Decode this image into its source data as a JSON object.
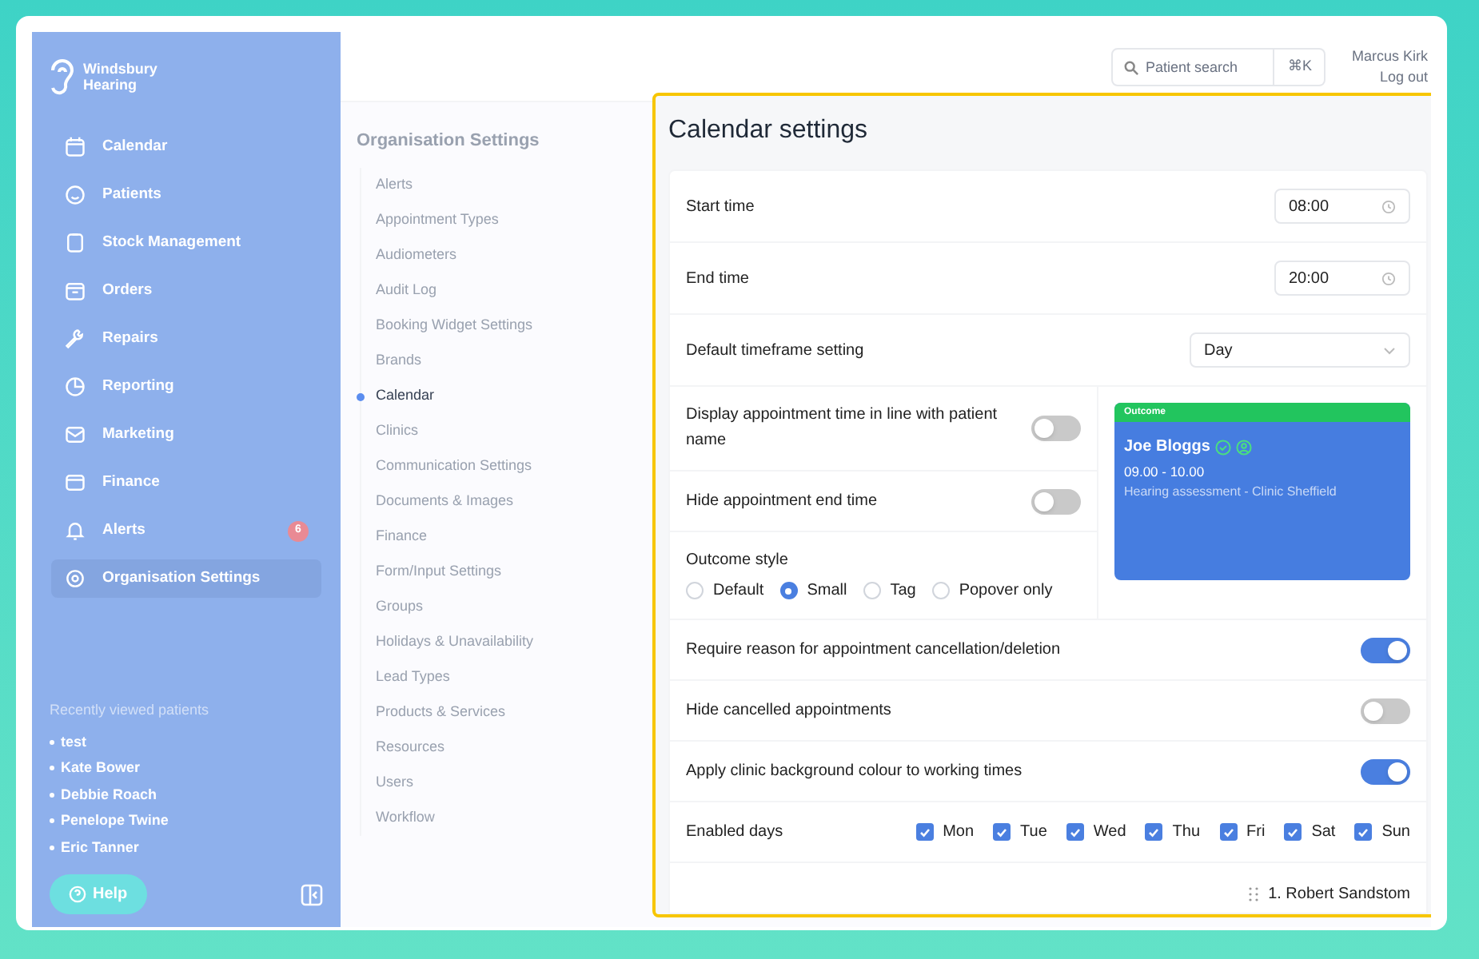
{
  "brand": {
    "line1": "Windsbury",
    "line2": "Hearing"
  },
  "nav": [
    {
      "label": "Calendar",
      "selected": false
    },
    {
      "label": "Patients",
      "selected": false
    },
    {
      "label": "Stock Management",
      "selected": false
    },
    {
      "label": "Orders",
      "selected": false
    },
    {
      "label": "Repairs",
      "selected": false
    },
    {
      "label": "Reporting",
      "selected": false
    },
    {
      "label": "Marketing",
      "selected": false
    },
    {
      "label": "Finance",
      "selected": false
    },
    {
      "label": "Alerts",
      "selected": false,
      "badge": "6"
    },
    {
      "label": "Organisation Settings",
      "selected": true
    }
  ],
  "recent": {
    "title": "Recently viewed patients",
    "items": [
      "test",
      "Kate Bower",
      "Debbie Roach",
      "Penelope Twine",
      "Eric Tanner"
    ]
  },
  "help": "Help",
  "header": {
    "search_placeholder": "Patient search",
    "shortcut": "⌘K",
    "user": "Marcus Kirk",
    "logout": "Log out"
  },
  "settings_nav": {
    "title": "Organisation Settings",
    "items": [
      {
        "label": "Alerts",
        "selected": false
      },
      {
        "label": "Appointment Types",
        "selected": false
      },
      {
        "label": "Audiometers",
        "selected": false
      },
      {
        "label": "Audit Log",
        "selected": false
      },
      {
        "label": "Booking Widget Settings",
        "selected": false
      },
      {
        "label": "Brands",
        "selected": false
      },
      {
        "label": "Calendar",
        "selected": true
      },
      {
        "label": "Clinics",
        "selected": false
      },
      {
        "label": "Communication Settings",
        "selected": false
      },
      {
        "label": "Documents & Images",
        "selected": false
      },
      {
        "label": "Finance",
        "selected": false
      },
      {
        "label": "Form/Input Settings",
        "selected": false
      },
      {
        "label": "Groups",
        "selected": false
      },
      {
        "label": "Holidays & Unavailability",
        "selected": false
      },
      {
        "label": "Lead Types",
        "selected": false
      },
      {
        "label": "Products & Services",
        "selected": false
      },
      {
        "label": "Resources",
        "selected": false
      },
      {
        "label": "Users",
        "selected": false
      },
      {
        "label": "Workflow",
        "selected": false
      }
    ]
  },
  "panel": {
    "title": "Calendar settings",
    "start_time": {
      "label": "Start time",
      "value": "08:00"
    },
    "end_time": {
      "label": "End time",
      "value": "20:00"
    },
    "timeframe": {
      "label": "Default timeframe setting",
      "value": "Day"
    },
    "display_toggles": [
      {
        "label": "Display appointment time in line with patient name",
        "on": false
      },
      {
        "label": "Hide appointment end time",
        "on": false
      }
    ],
    "outcome_style": {
      "label": "Outcome style",
      "options": [
        {
          "label": "Default",
          "selected": false
        },
        {
          "label": "Small",
          "selected": true
        },
        {
          "label": "Tag",
          "selected": false
        },
        {
          "label": "Popover only",
          "selected": false
        }
      ]
    },
    "preview": {
      "tag": "Outcome",
      "name": "Joe Bloggs",
      "time": "09.00 - 10.00",
      "detail": "Hearing assessment - Clinic Sheffield"
    },
    "toggles": [
      {
        "label": "Require reason for appointment cancellation/deletion",
        "on": true
      },
      {
        "label": "Hide cancelled appointments",
        "on": false
      },
      {
        "label": "Apply clinic background colour to working times",
        "on": true
      }
    ],
    "enabled_days": {
      "label": "Enabled days",
      "days": [
        {
          "label": "Mon",
          "checked": true
        },
        {
          "label": "Tue",
          "checked": true
        },
        {
          "label": "Wed",
          "checked": true
        },
        {
          "label": "Thu",
          "checked": true
        },
        {
          "label": "Fri",
          "checked": true
        },
        {
          "label": "Sat",
          "checked": true
        },
        {
          "label": "Sun",
          "checked": true
        }
      ]
    },
    "order_list": [
      "1. Robert Sandstom"
    ]
  }
}
